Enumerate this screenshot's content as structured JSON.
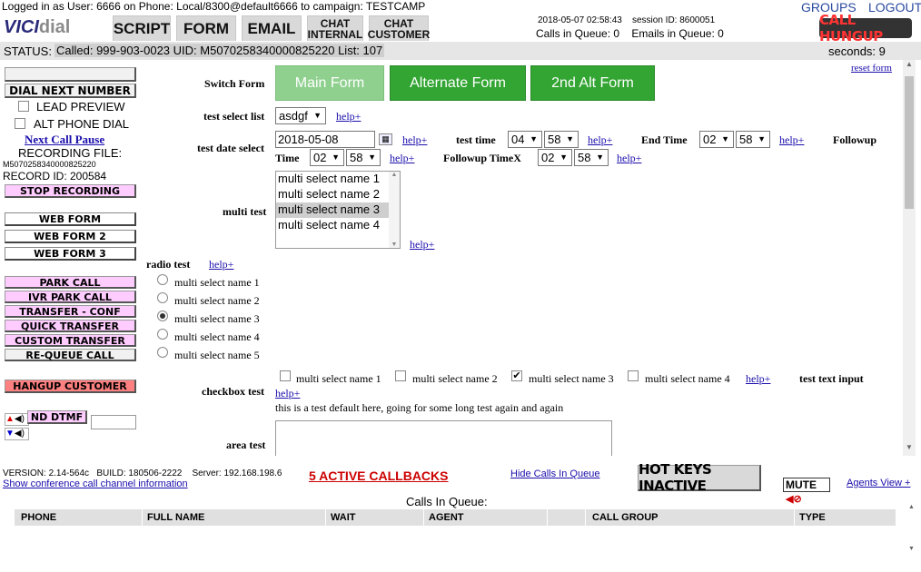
{
  "header": {
    "logged_in": "Logged in as User: 6666 on Phone: Local/8300@default6666  to campaign: TESTCAMP",
    "logo_main": "VICI",
    "logo_sub": "dial",
    "tabs": [
      "SCRIPT",
      "FORM",
      "EMAIL"
    ],
    "chat_internal": [
      "CHAT",
      "INTERNAL"
    ],
    "chat_customer": [
      "CHAT",
      "CUSTOMER"
    ],
    "datetime": "2018-05-07 02:58:43",
    "session": "session ID: 8600051",
    "calls_in_queue": "Calls in Queue: 0",
    "emails_in_queue": "Emails in Queue: 0",
    "groups": "GROUPS",
    "logout": "LOGOUT",
    "call_hungup": "CALL HUNGUP"
  },
  "status": {
    "label": "STATUS:",
    "text": "Called: 999-903-0023 UID: M5070258340000825220 List: 107",
    "seconds": "seconds: 9"
  },
  "left": {
    "dial_next": "DIAL NEXT NUMBER",
    "lead_preview": "LEAD PREVIEW",
    "alt_phone": "ALT PHONE DIAL",
    "next_call_pause": "Next Call Pause",
    "recording_file": "RECORDING FILE:",
    "recording_id": "M5070258340000825220",
    "record_id": "RECORD ID: 200584",
    "stop_recording": "STOP RECORDING",
    "web_form": "WEB FORM",
    "web_form2": "WEB FORM 2",
    "web_form3": "WEB FORM 3",
    "park_call": "PARK CALL",
    "ivr_park": "IVR PARK CALL",
    "transfer": "TRANSFER - CONF",
    "quick_transfer": "QUICK TRANSFER",
    "custom_transfer": "CUSTOM TRANSFER",
    "requeue": "RE-QUEUE CALL",
    "hangup": "HANGUP CUSTOMER",
    "dtmf": "ND DTMF"
  },
  "form": {
    "reset_form": "reset form",
    "switch_form": "Switch Form",
    "main_form": "Main Form",
    "alt_form": "Alternate Form",
    "alt2_form": "2nd Alt Form",
    "help": "help+",
    "test_select_label": "test select list",
    "test_select_value": "asdgf",
    "test_date_label": "test date select",
    "test_date_value": "2018-05-08",
    "test_time_label": "test time",
    "test_time_h": "04",
    "test_time_m": "58",
    "end_time_label": "End Time",
    "end_time_h": "02",
    "end_time_m": "58",
    "followup_label": "Followup",
    "time_label": "Time",
    "time_h": "02",
    "time_m": "58",
    "followup_timex_label": "Followup TimeX",
    "fx_h": "02",
    "fx_m": "58",
    "multi_test_label": "multi test",
    "multi_options": [
      "multi select name 1",
      "multi select name 2",
      "multi select name 3",
      "multi select name 4"
    ],
    "radio_test_label": "radio test",
    "radio_options": [
      "multi select name 1",
      "multi select name 2",
      "multi select name 3",
      "multi select name 4",
      "multi select name 5"
    ],
    "checkbox_label": "checkbox test",
    "checkbox_options": [
      "multi select name 1",
      "multi select name 2",
      "multi select name 3",
      "multi select name 4"
    ],
    "test_text_input_label": "test text input",
    "default_text": "this is a test default here, going for some long test again and again",
    "area_test_label": "area test"
  },
  "bottom": {
    "version": "VERSION: 2.14-564c   BUILD: 180506-2222    Server: 192.168.198.6",
    "show_conf": "Show conference call channel information",
    "active_callbacks": "5 ACTIVE CALLBACKS",
    "hide_calls": "Hide Calls In Queue",
    "hot_keys": "HOT KEYS INACTIVE",
    "mute": "MUTE",
    "agents_view": "Agents View +",
    "calls_in_queue_title": "Calls In Queue:",
    "columns": [
      "PHONE",
      "FULL NAME",
      "WAIT",
      "AGENT",
      "CALL GROUP",
      "TYPE"
    ]
  },
  "colors": {
    "green_button": "#33a533",
    "green_active": "#8fd08f",
    "pink_button": "#ffccff",
    "red_button": "#ff8080",
    "callbacks_red": "#cc0000"
  }
}
